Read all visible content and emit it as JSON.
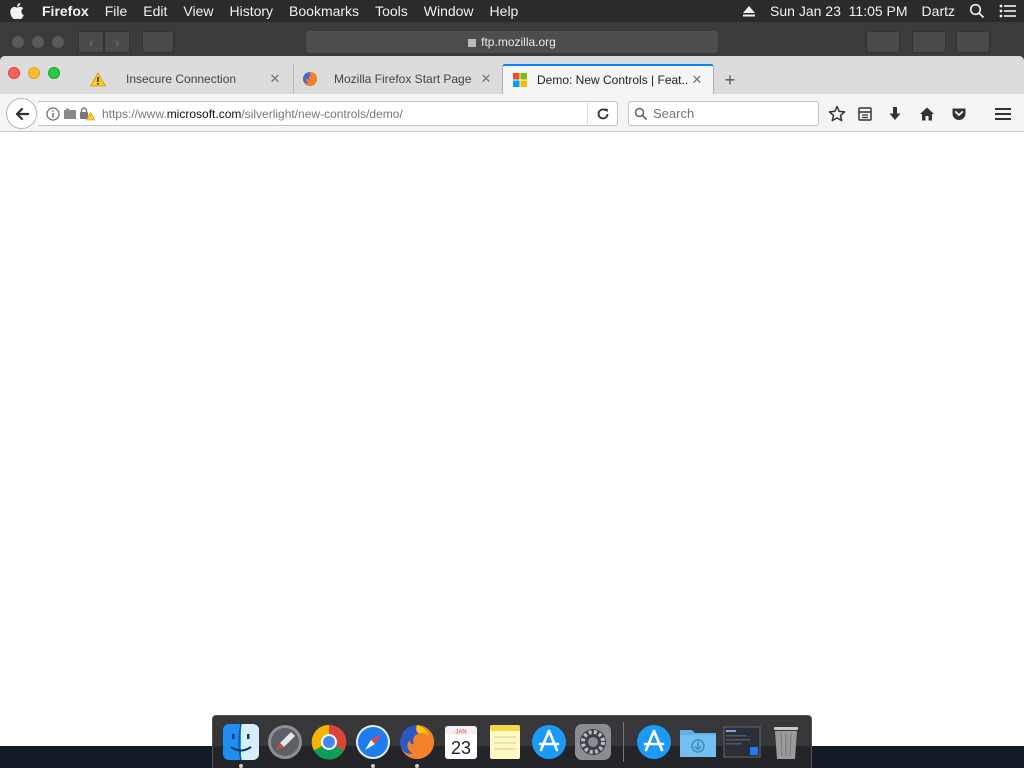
{
  "menubar": {
    "apple_icon": "apple-logo-icon",
    "items": [
      "Firefox",
      "File",
      "Edit",
      "View",
      "History",
      "Bookmarks",
      "Tools",
      "Window",
      "Help"
    ],
    "status": {
      "eject_icon": "eject-icon",
      "datetime": "Sun Jan 23  11:05 PM",
      "user": "Dartz",
      "search_icon": "spotlight-search-icon",
      "list_icon": "notification-center-icon"
    }
  },
  "background_window": {
    "address": "ftp.mozilla.org"
  },
  "firefox": {
    "tabs": [
      {
        "title": "Insecure Connection",
        "favicon": "warning-icon",
        "active": false
      },
      {
        "title": "Mozilla Firefox Start Page",
        "favicon": "firefox-icon",
        "active": false
      },
      {
        "title": "Demo: New Controls | Feat...",
        "favicon": "microsoft-logo-icon",
        "active": true
      }
    ],
    "new_tab_label": "+",
    "url": {
      "prefix": "https://www.",
      "host": "microsoft.com",
      "path": "/silverlight/new-controls/demo/"
    },
    "search": {
      "placeholder": "Search",
      "value": ""
    }
  },
  "dock": {
    "apps": [
      {
        "name": "Finder",
        "icon": "finder-icon",
        "running": true
      },
      {
        "name": "Launchpad",
        "icon": "launchpad-icon",
        "running": false
      },
      {
        "name": "Google Chrome",
        "icon": "chrome-icon",
        "running": false
      },
      {
        "name": "Safari",
        "icon": "safari-icon",
        "running": true
      },
      {
        "name": "Firefox",
        "icon": "firefox-icon",
        "running": true
      },
      {
        "name": "Calendar",
        "icon": "calendar-icon",
        "running": false,
        "month": "JAN",
        "day": "23"
      },
      {
        "name": "Notes",
        "icon": "notes-icon",
        "running": false
      },
      {
        "name": "App Store",
        "icon": "app-store-icon",
        "running": false
      },
      {
        "name": "System Preferences",
        "icon": "system-preferences-icon",
        "running": false
      }
    ],
    "others": [
      {
        "name": "Applications",
        "icon": "applications-folder-icon"
      },
      {
        "name": "Downloads",
        "icon": "downloads-folder-icon"
      },
      {
        "name": "Screenshot",
        "icon": "screenshot-icon"
      },
      {
        "name": "Trash",
        "icon": "trash-icon"
      }
    ]
  }
}
